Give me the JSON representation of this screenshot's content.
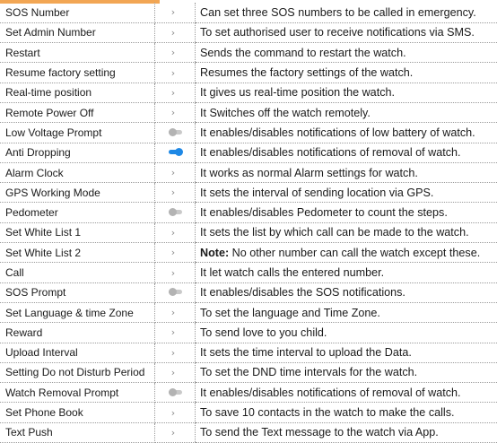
{
  "rows": [
    {
      "name": "SOS Number",
      "control": "chevron",
      "note": "",
      "description": "Can set three SOS numbers to be called in emergency."
    },
    {
      "name": "Set Admin Number",
      "control": "chevron",
      "note": "",
      "description": "To set authorised user to receive notifications via SMS."
    },
    {
      "name": "Restart",
      "control": "chevron",
      "note": "",
      "description": "Sends the command to restart the watch."
    },
    {
      "name": "Resume factory setting",
      "control": "chevron",
      "note": "",
      "description": "Resumes the factory settings of the watch."
    },
    {
      "name": "Real-time position",
      "control": "chevron",
      "note": "",
      "description": "It gives us real-time position the watch."
    },
    {
      "name": "Remote Power Off",
      "control": "chevron",
      "note": "",
      "description": "It Switches off the watch remotely."
    },
    {
      "name": "Low Voltage Prompt",
      "control": "toggle-off",
      "note": "",
      "description": "It enables/disables notifications of low battery of watch."
    },
    {
      "name": "Anti Dropping",
      "control": "toggle-on",
      "note": "",
      "description": "It enables/disables notifications of removal of watch."
    },
    {
      "name": "Alarm Clock",
      "control": "chevron",
      "note": "",
      "description": "It works as normal Alarm settings for watch."
    },
    {
      "name": "GPS Working Mode",
      "control": "chevron",
      "note": "",
      "description": "It sets the interval of sending location via GPS."
    },
    {
      "name": "Pedometer",
      "control": "toggle-off",
      "note": "",
      "description": "It enables/disables Pedometer to count the steps."
    },
    {
      "name": "Set White List 1",
      "control": "chevron",
      "note": "",
      "description": "It sets the list by which call can be made to the watch."
    },
    {
      "name": "Set White List 2",
      "control": "chevron",
      "note": "Note:",
      "description": " No other number can call the watch except these."
    },
    {
      "name": "Call",
      "control": "chevron",
      "note": "",
      "description": "It let watch calls the entered number."
    },
    {
      "name": "SOS Prompt",
      "control": "toggle-off",
      "note": "",
      "description": "It enables/disables the SOS notifications."
    },
    {
      "name": "Set Language & time Zone",
      "control": "chevron",
      "note": "",
      "description": "To set the language and Time Zone."
    },
    {
      "name": "Reward",
      "control": "chevron",
      "note": "",
      "description": "To send love to you child."
    },
    {
      "name": "Upload Interval",
      "control": "chevron",
      "note": "",
      "description": "It sets the time interval to upload the Data."
    },
    {
      "name": "Setting Do not Disturb Period",
      "control": "chevron",
      "note": "",
      "description": "To set the DND time intervals for the watch."
    },
    {
      "name": "Watch Removal  Prompt",
      "control": "toggle-off",
      "note": "",
      "description": "It enables/disables notifications of removal of watch."
    },
    {
      "name": "Set Phone Book",
      "control": "chevron",
      "note": "",
      "description": "To save 10 contacts in the watch to make the calls."
    },
    {
      "name": "Text Push",
      "control": "chevron",
      "note": "",
      "description": "To send the Text message to the watch via App."
    }
  ],
  "glyphs": {
    "chevron": "›"
  },
  "colors": {
    "accent": "#f2a654",
    "toggle_on": "#1e88e5",
    "toggle_off": "#c9c9c9"
  }
}
